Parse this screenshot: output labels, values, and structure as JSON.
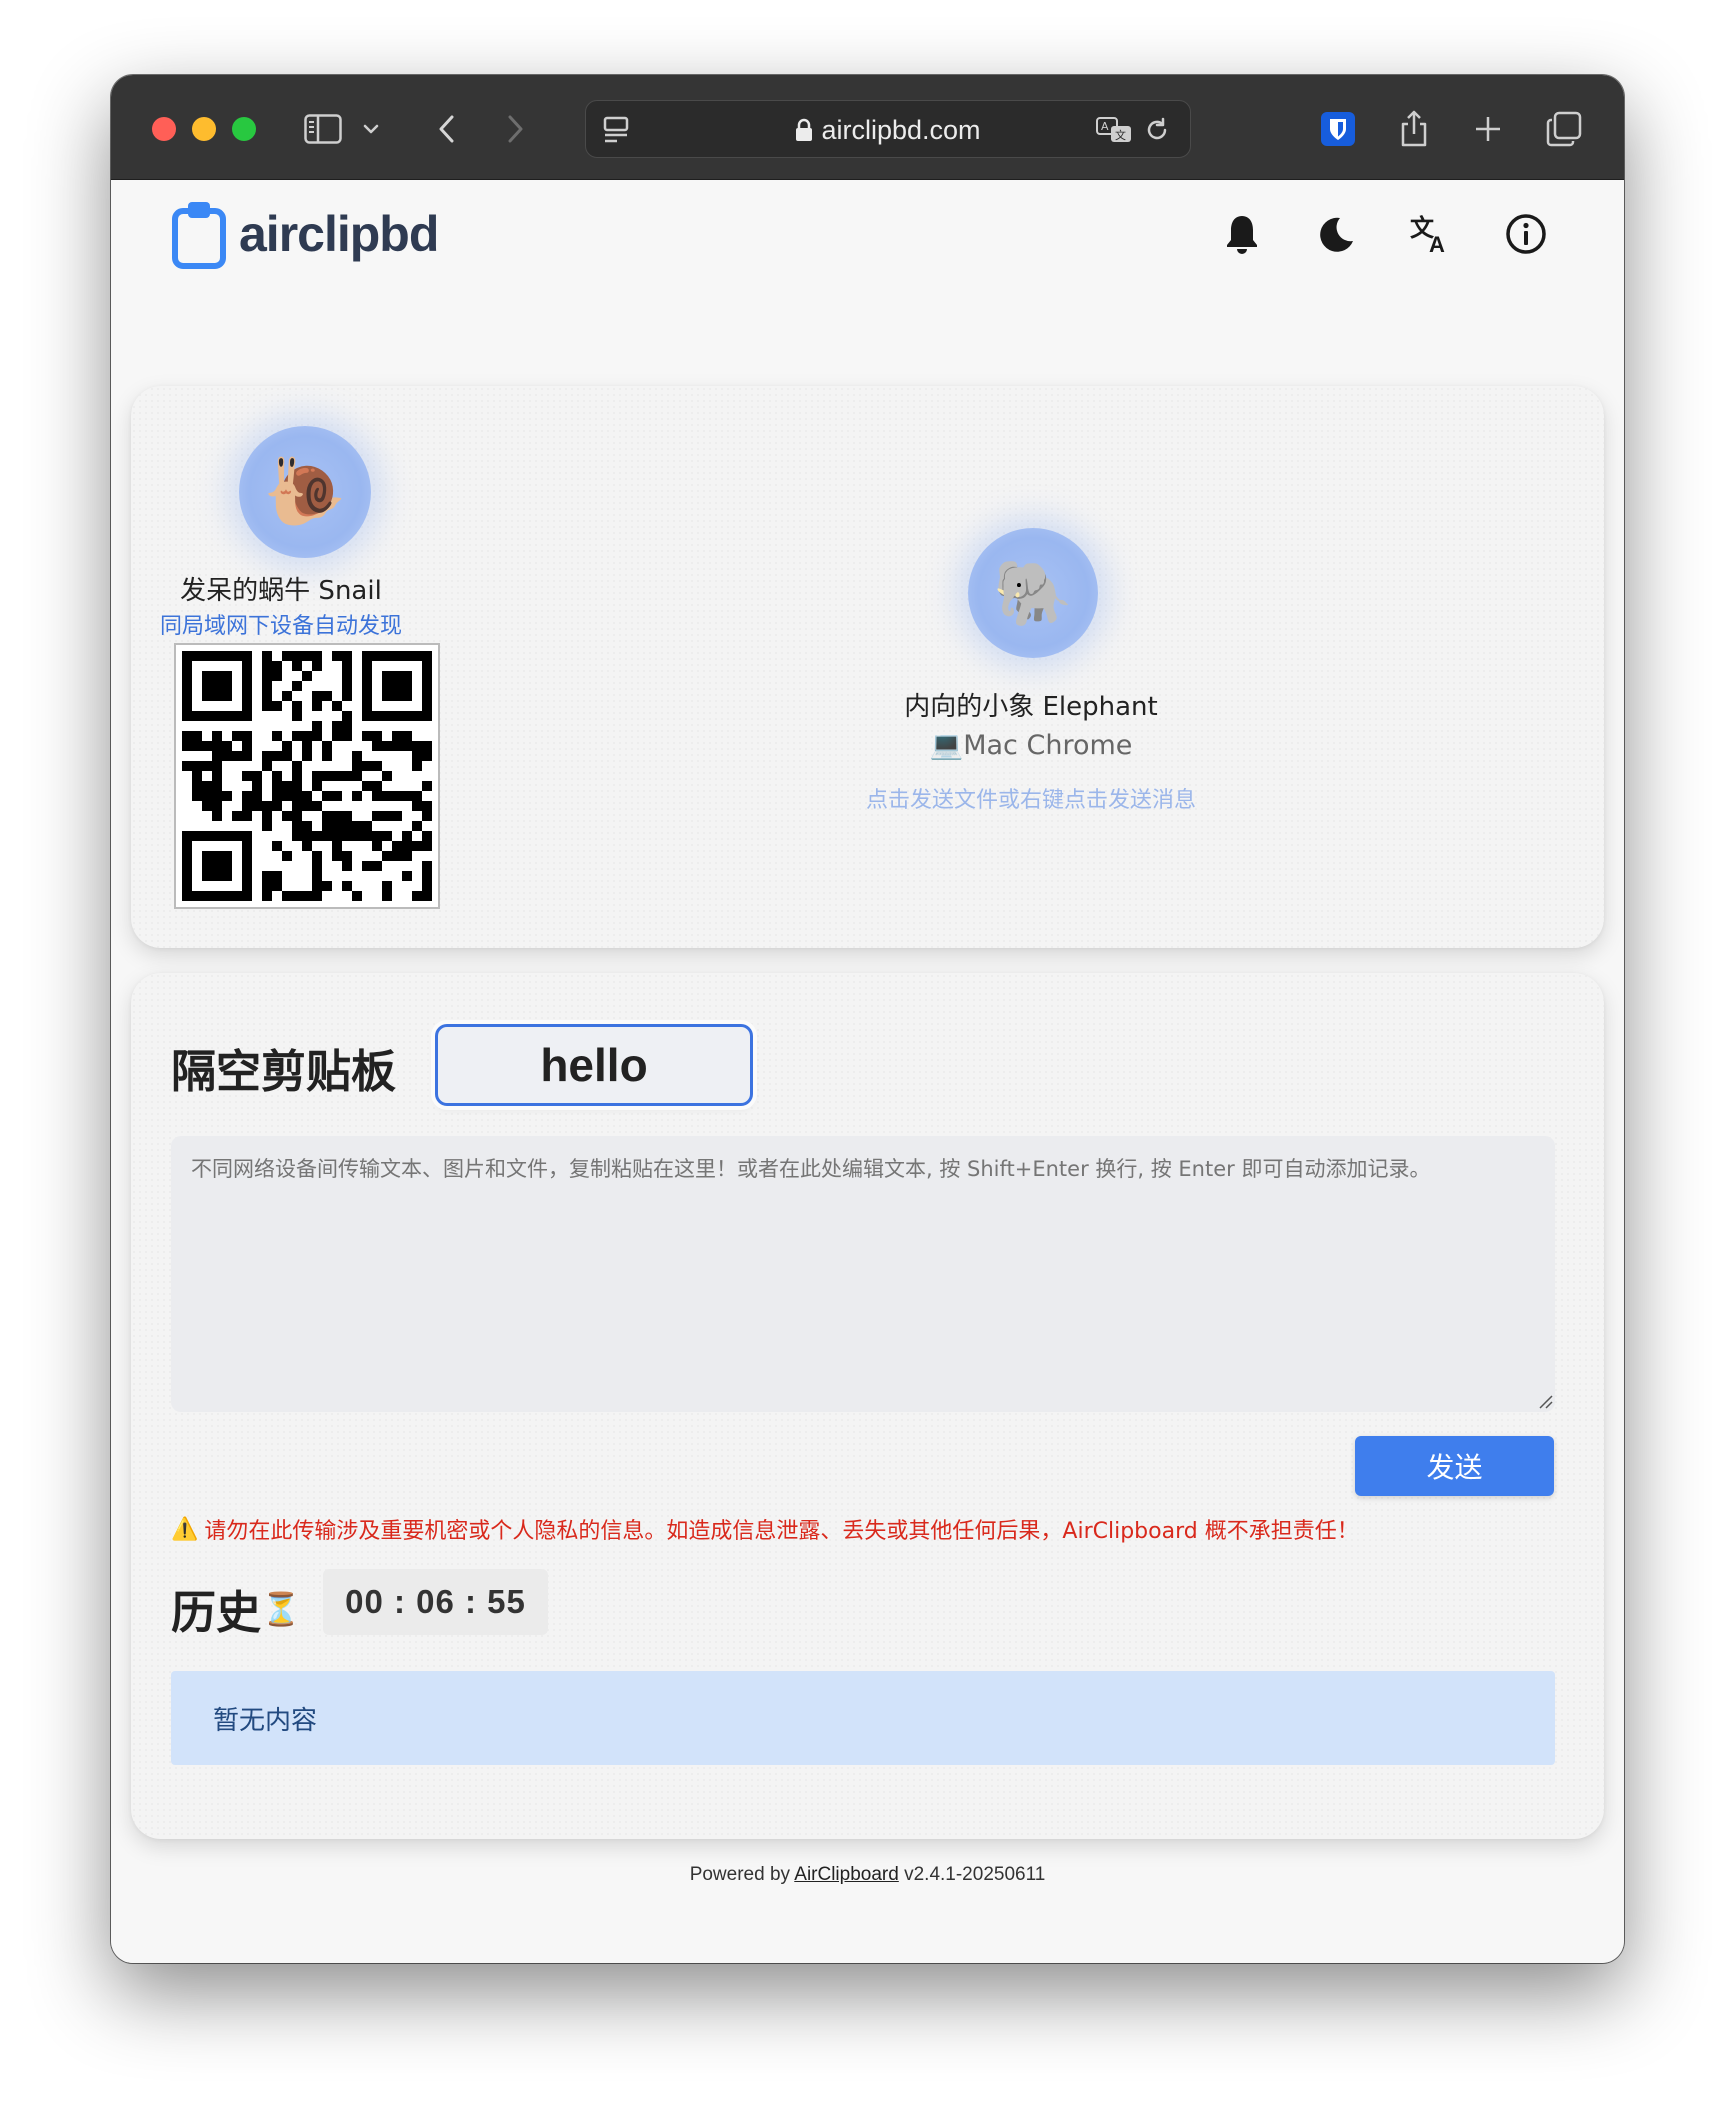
{
  "browser": {
    "url": "airclipbd.com"
  },
  "header": {
    "logo_text": "airclipbd",
    "icons": [
      "bell-icon",
      "moon-icon",
      "translate-icon",
      "info-icon"
    ]
  },
  "devices": {
    "self": {
      "emoji": "🐌",
      "name": "发呆的蜗牛 Snail",
      "hint": "同局域网下设备自动发现"
    },
    "peer": {
      "emoji": "🐘",
      "name": "内向的小象 Elephant",
      "device_icon": "💻",
      "device": "Mac Chrome",
      "hint": "点击发送文件或右键点击发送消息"
    }
  },
  "clipboard": {
    "title": "隔空剪贴板",
    "room_code": "hello",
    "placeholder": "不同网络设备间传输文本、图片和文件，复制粘贴在这里！或者在此处编辑文本, 按 Shift+Enter 换行, 按 Enter 即可自动添加记录。",
    "send_label": "发送",
    "warning_icon": "⚠️",
    "warning": "请勿在此传输涉及重要机密或个人隐私的信息。如造成信息泄露、丢失或其他任何后果，AirClipboard 概不承担责任！"
  },
  "history": {
    "title": "历史",
    "hourglass": "⏳",
    "timer": "00 : 06 : 55",
    "empty_text": "暂无内容"
  },
  "footer": {
    "prefix": "Powered by",
    "link": "AirClipboard",
    "version": "v2.4.1-20250611"
  },
  "colors": {
    "accent": "#3f7eed",
    "warning": "#d9291c",
    "avatar": "#9ab7f0"
  }
}
